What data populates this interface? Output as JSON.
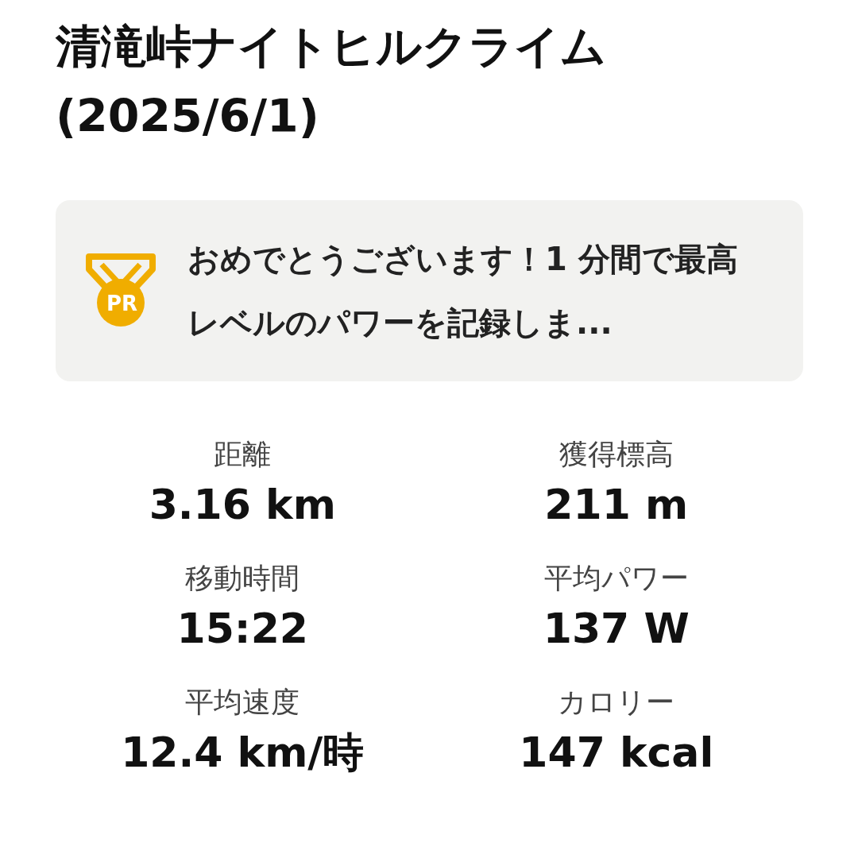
{
  "title": "清滝峠ナイトヒルクライム (2025/6/1)",
  "achievement": {
    "badge": "PR",
    "message": "おめでとうございます！1 分間で最高レベルのパワーを記録しま..."
  },
  "stats": [
    {
      "label": "距離",
      "value": "3.16 km"
    },
    {
      "label": "獲得標高",
      "value": "211 m"
    },
    {
      "label": "移動時間",
      "value": "15:22"
    },
    {
      "label": "平均パワー",
      "value": "137 W"
    },
    {
      "label": "平均速度",
      "value": "12.4 km/時"
    },
    {
      "label": "カロリー",
      "value": "147 kcal"
    }
  ]
}
